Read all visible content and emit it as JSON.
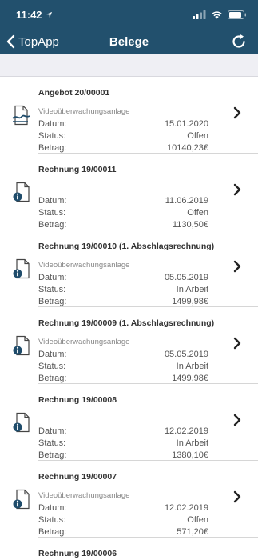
{
  "status": {
    "time": "11:42"
  },
  "nav": {
    "back_label": "TopApp",
    "title": "Belege"
  },
  "labels": {
    "date": "Datum:",
    "status": "Status:",
    "amount": "Betrag:"
  },
  "docs": [
    {
      "title": "Angebot 20/00001",
      "desc": "Videoüberwachungsanlage",
      "date": "15.01.2020",
      "status": "Offen",
      "amount": "10140,23€",
      "icon": "quote-document-icon"
    },
    {
      "title": "Rechnung 19/00011",
      "desc": "",
      "date": "11.06.2019",
      "status": "Offen",
      "amount": "1130,50€",
      "icon": "invoice-document-icon"
    },
    {
      "title": "Rechnung 19/00010 (1. Abschlagsrechnung)",
      "desc": "Videoüberwachungsanlage",
      "date": "05.05.2019",
      "status": "In Arbeit",
      "amount": "1499,98€",
      "icon": "invoice-document-icon"
    },
    {
      "title": "Rechnung 19/00009 (1. Abschlagsrechnung)",
      "desc": "Videoüberwachungsanlage",
      "date": "05.05.2019",
      "status": "In Arbeit",
      "amount": "1499,98€",
      "icon": "invoice-document-icon"
    },
    {
      "title": "Rechnung 19/00008",
      "desc": "",
      "date": "12.02.2019",
      "status": "In Arbeit",
      "amount": "1380,10€",
      "icon": "invoice-document-icon"
    },
    {
      "title": "Rechnung 19/00007",
      "desc": "Videoüberwachungsanlage",
      "date": "12.02.2019",
      "status": "Offen",
      "amount": "571,20€",
      "icon": "invoice-document-icon"
    },
    {
      "title": "Rechnung 19/00006",
      "desc": "",
      "date": "",
      "status": "",
      "amount": "",
      "icon": "invoice-document-icon"
    }
  ]
}
